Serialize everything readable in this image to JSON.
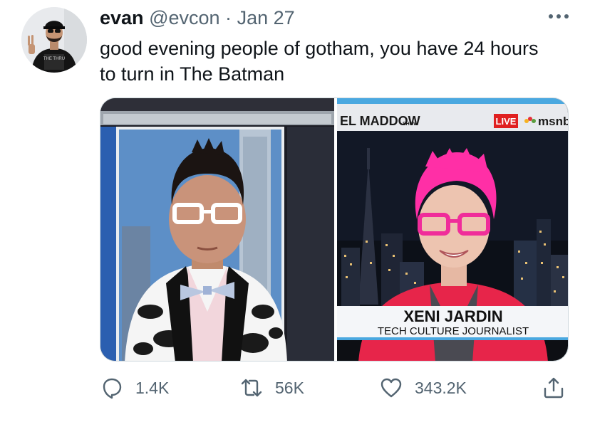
{
  "user": {
    "display_name": "evan",
    "handle": "@evcon",
    "separator": "·",
    "date": "Jan 27",
    "avatar_shirt_text": "THE THRU"
  },
  "tweet": {
    "text": "good evening people of gotham, you have 24 hours to turn in The Batman"
  },
  "media": {
    "show_name": "EL MADDOW",
    "show_suffix": "SHOW",
    "live_badge": "LIVE",
    "network": "msnbc",
    "lower_third_name": "XENI JARDIN",
    "lower_third_title": "TECH CULTURE JOURNALIST"
  },
  "actions": {
    "reply_count": "1.4K",
    "retweet_count": "56K",
    "like_count": "343.2K"
  },
  "icons": {
    "more": "more-horizontal-icon",
    "reply": "reply-icon",
    "retweet": "retweet-icon",
    "like": "heart-icon",
    "share": "share-icon"
  },
  "colors": {
    "text": "#0f1419",
    "muted": "#536471",
    "msnbc_red": "#e02020",
    "hair_pink": "#ff2fa6",
    "blazer_red": "#e7254a"
  }
}
